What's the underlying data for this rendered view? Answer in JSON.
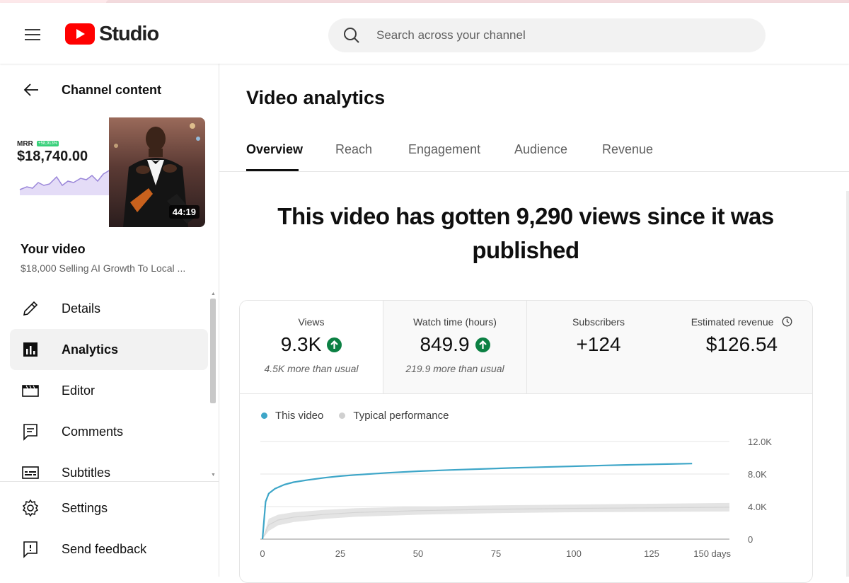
{
  "app": {
    "logo_text": "Studio",
    "brand_color": "#ff0000"
  },
  "search": {
    "placeholder": "Search across your channel"
  },
  "sidebar": {
    "back_label": "Channel content",
    "thumbnail": {
      "mrr_label": "MRR",
      "mrr_badge": "+58,913%",
      "mrr_amount": "$18,740.00",
      "duration": "44:19"
    },
    "your_video_label": "Your video",
    "video_title": "$18,000 Selling AI Growth To Local ...",
    "items": [
      {
        "label": "Details",
        "icon": "pencil-icon"
      },
      {
        "label": "Analytics",
        "icon": "analytics-icon",
        "active": true
      },
      {
        "label": "Editor",
        "icon": "clapperboard-icon"
      },
      {
        "label": "Comments",
        "icon": "comment-icon"
      },
      {
        "label": "Subtitles",
        "icon": "subtitles-icon"
      }
    ],
    "bottom_items": [
      {
        "label": "Settings",
        "icon": "gear-icon"
      },
      {
        "label": "Send feedback",
        "icon": "feedback-icon"
      }
    ]
  },
  "main": {
    "page_title": "Video analytics",
    "tabs": [
      {
        "label": "Overview",
        "active": true
      },
      {
        "label": "Reach"
      },
      {
        "label": "Engagement"
      },
      {
        "label": "Audience"
      },
      {
        "label": "Revenue"
      }
    ],
    "headline": "This video has gotten 9,290 views since it was published",
    "metrics": [
      {
        "label": "Views",
        "value": "9.3K",
        "trend": "up",
        "sub": "4.5K more than usual"
      },
      {
        "label": "Watch time (hours)",
        "value": "849.9",
        "trend": "up",
        "sub": "219.9 more than usual"
      },
      {
        "label": "Subscribers",
        "value": "+124"
      },
      {
        "label": "Estimated revenue",
        "value": "$126.54"
      }
    ],
    "legend": [
      {
        "label": "This video",
        "color": "#3ea6c8"
      },
      {
        "label": "Typical performance",
        "color": "#d0d0d0"
      }
    ]
  },
  "chart_data": {
    "type": "line",
    "x_tick_labels": [
      "0",
      "25",
      "50",
      "75",
      "100",
      "125",
      "150 days"
    ],
    "x_ticks": [
      0,
      25,
      50,
      75,
      100,
      125,
      150
    ],
    "y_tick_labels": [
      "12.0K",
      "8.0K",
      "4.0K",
      "0"
    ],
    "y_ticks": [
      12000,
      8000,
      4000,
      0
    ],
    "xlim": [
      0,
      150
    ],
    "ylim": [
      0,
      12000
    ],
    "series": [
      {
        "name": "This video",
        "color": "#3ea6c8",
        "x": [
          0,
          1,
          2,
          4,
          7,
          10,
          15,
          20,
          25,
          30,
          40,
          50,
          60,
          70,
          80,
          90,
          100,
          110,
          120,
          130,
          138
        ],
        "y": [
          0,
          4600,
          5600,
          6200,
          6700,
          7000,
          7300,
          7550,
          7750,
          7900,
          8150,
          8350,
          8500,
          8620,
          8750,
          8850,
          8960,
          9060,
          9150,
          9230,
          9290
        ]
      },
      {
        "name": "Typical performance",
        "color": "#e4e4e4",
        "x": [
          0,
          2,
          5,
          10,
          20,
          30,
          50,
          75,
          100,
          125,
          150
        ],
        "low": [
          0,
          1000,
          1700,
          2100,
          2500,
          2750,
          3000,
          3200,
          3300,
          3350,
          3400
        ],
        "high": [
          0,
          2500,
          3000,
          3300,
          3600,
          3800,
          4000,
          4150,
          4250,
          4350,
          4450
        ]
      }
    ]
  }
}
